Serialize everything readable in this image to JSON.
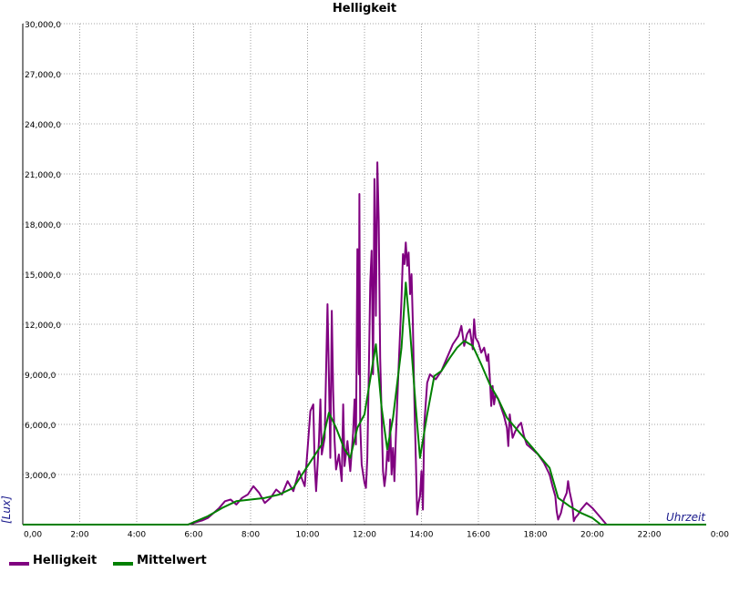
{
  "chart_data": {
    "type": "line",
    "title": "Helligkeit",
    "xlabel": "Uhrzeit",
    "ylabel": "[Lux]",
    "x_ticks": [
      "0,00",
      "2:00",
      "4:00",
      "6:00",
      "8:00",
      "10:00",
      "12:00",
      "14:00",
      "16:00",
      "18:00",
      "20:00",
      "22:00",
      "0:00"
    ],
    "y_ticks": [
      "3,000,0",
      "6,000,0",
      "9,000,0",
      "12,000,0",
      "15,000,0",
      "18,000,0",
      "21,000,0",
      "24,000,0",
      "27,000,0",
      "30,000,0"
    ],
    "xlim": [
      0,
      24
    ],
    "ylim": [
      0,
      30000
    ],
    "grid": true,
    "legend_position": "bottom-left",
    "series": [
      {
        "name": "Helligkeit",
        "color": "#800080",
        "points": [
          [
            0,
            0
          ],
          [
            5.8,
            0
          ],
          [
            6.0,
            100
          ],
          [
            6.3,
            250
          ],
          [
            6.5,
            400
          ],
          [
            6.7,
            700
          ],
          [
            6.9,
            1000
          ],
          [
            7.1,
            1400
          ],
          [
            7.3,
            1500
          ],
          [
            7.5,
            1200
          ],
          [
            7.7,
            1600
          ],
          [
            7.9,
            1800
          ],
          [
            8.1,
            2300
          ],
          [
            8.3,
            1900
          ],
          [
            8.5,
            1300
          ],
          [
            8.7,
            1600
          ],
          [
            8.9,
            2100
          ],
          [
            9.1,
            1800
          ],
          [
            9.3,
            2600
          ],
          [
            9.5,
            2000
          ],
          [
            9.7,
            3200
          ],
          [
            9.9,
            2300
          ],
          [
            10.0,
            4500
          ],
          [
            10.1,
            6800
          ],
          [
            10.2,
            7200
          ],
          [
            10.25,
            3600
          ],
          [
            10.3,
            2000
          ],
          [
            10.4,
            5000
          ],
          [
            10.45,
            7500
          ],
          [
            10.5,
            4200
          ],
          [
            10.6,
            5200
          ],
          [
            10.7,
            13200
          ],
          [
            10.75,
            9000
          ],
          [
            10.8,
            4000
          ],
          [
            10.85,
            12800
          ],
          [
            10.9,
            8000
          ],
          [
            10.95,
            5000
          ],
          [
            11.0,
            3300
          ],
          [
            11.1,
            4200
          ],
          [
            11.2,
            2600
          ],
          [
            11.25,
            7200
          ],
          [
            11.3,
            3500
          ],
          [
            11.4,
            5000
          ],
          [
            11.5,
            3200
          ],
          [
            11.6,
            5500
          ],
          [
            11.65,
            7500
          ],
          [
            11.7,
            4800
          ],
          [
            11.75,
            16500
          ],
          [
            11.8,
            9000
          ],
          [
            11.82,
            19800
          ],
          [
            11.85,
            6000
          ],
          [
            11.9,
            3600
          ],
          [
            12.0,
            2500
          ],
          [
            12.05,
            2200
          ],
          [
            12.1,
            4000
          ],
          [
            12.15,
            9000
          ],
          [
            12.2,
            14500
          ],
          [
            12.25,
            16400
          ],
          [
            12.3,
            9000
          ],
          [
            12.35,
            20700
          ],
          [
            12.4,
            12500
          ],
          [
            12.45,
            21700
          ],
          [
            12.5,
            18200
          ],
          [
            12.55,
            10000
          ],
          [
            12.6,
            6500
          ],
          [
            12.65,
            3200
          ],
          [
            12.7,
            2300
          ],
          [
            12.75,
            3000
          ],
          [
            12.8,
            4400
          ],
          [
            12.85,
            3800
          ],
          [
            12.9,
            6300
          ],
          [
            12.95,
            3000
          ],
          [
            13.0,
            4600
          ],
          [
            13.05,
            2600
          ],
          [
            13.1,
            5200
          ],
          [
            13.2,
            9500
          ],
          [
            13.3,
            13500
          ],
          [
            13.35,
            16200
          ],
          [
            13.4,
            15600
          ],
          [
            13.45,
            16900
          ],
          [
            13.5,
            15500
          ],
          [
            13.55,
            16300
          ],
          [
            13.6,
            13800
          ],
          [
            13.65,
            15000
          ],
          [
            13.7,
            12000
          ],
          [
            13.75,
            7500
          ],
          [
            13.8,
            4000
          ],
          [
            13.85,
            600
          ],
          [
            13.9,
            1300
          ],
          [
            13.95,
            1700
          ],
          [
            14.0,
            3200
          ],
          [
            14.05,
            900
          ],
          [
            14.1,
            6000
          ],
          [
            14.2,
            8500
          ],
          [
            14.3,
            9000
          ],
          [
            14.5,
            8700
          ],
          [
            14.7,
            9200
          ],
          [
            14.9,
            10000
          ],
          [
            15.1,
            10800
          ],
          [
            15.3,
            11300
          ],
          [
            15.4,
            11900
          ],
          [
            15.5,
            10700
          ],
          [
            15.6,
            11400
          ],
          [
            15.7,
            11700
          ],
          [
            15.8,
            10500
          ],
          [
            15.85,
            12300
          ],
          [
            15.9,
            11200
          ],
          [
            16.0,
            10900
          ],
          [
            16.1,
            10300
          ],
          [
            16.2,
            10600
          ],
          [
            16.3,
            9800
          ],
          [
            16.35,
            10200
          ],
          [
            16.4,
            8800
          ],
          [
            16.45,
            7100
          ],
          [
            16.5,
            8300
          ],
          [
            16.55,
            7200
          ],
          [
            16.6,
            7800
          ],
          [
            16.7,
            7500
          ],
          [
            16.8,
            7000
          ],
          [
            16.9,
            6500
          ],
          [
            17.0,
            5800
          ],
          [
            17.05,
            4700
          ],
          [
            17.1,
            6600
          ],
          [
            17.2,
            5200
          ],
          [
            17.3,
            5600
          ],
          [
            17.4,
            5900
          ],
          [
            17.5,
            6100
          ],
          [
            17.6,
            5300
          ],
          [
            17.7,
            4800
          ],
          [
            17.9,
            4500
          ],
          [
            18.1,
            4200
          ],
          [
            18.3,
            3700
          ],
          [
            18.5,
            3000
          ],
          [
            18.6,
            2300
          ],
          [
            18.7,
            1700
          ],
          [
            18.75,
            800
          ],
          [
            18.8,
            300
          ],
          [
            18.9,
            700
          ],
          [
            19.0,
            1500
          ],
          [
            19.1,
            1900
          ],
          [
            19.15,
            2600
          ],
          [
            19.2,
            2000
          ],
          [
            19.3,
            1200
          ],
          [
            19.35,
            200
          ],
          [
            19.4,
            400
          ],
          [
            19.5,
            600
          ],
          [
            19.6,
            900
          ],
          [
            19.8,
            1300
          ],
          [
            20.0,
            1000
          ],
          [
            20.2,
            600
          ],
          [
            20.5,
            0
          ],
          [
            24,
            0
          ]
        ]
      },
      {
        "name": "Mittelwert",
        "color": "#008000",
        "points": [
          [
            0,
            0
          ],
          [
            5.8,
            0
          ],
          [
            6.5,
            500
          ],
          [
            7.0,
            1000
          ],
          [
            7.5,
            1400
          ],
          [
            8.0,
            1500
          ],
          [
            8.5,
            1600
          ],
          [
            9.0,
            1800
          ],
          [
            9.5,
            2200
          ],
          [
            10.0,
            3500
          ],
          [
            10.5,
            4800
          ],
          [
            10.75,
            6700
          ],
          [
            11.0,
            5800
          ],
          [
            11.3,
            4500
          ],
          [
            11.5,
            4000
          ],
          [
            11.75,
            5800
          ],
          [
            12.0,
            6600
          ],
          [
            12.4,
            10800
          ],
          [
            12.6,
            7000
          ],
          [
            12.8,
            4500
          ],
          [
            13.0,
            6400
          ],
          [
            13.3,
            10600
          ],
          [
            13.45,
            14500
          ],
          [
            13.6,
            11600
          ],
          [
            13.8,
            7000
          ],
          [
            13.95,
            4000
          ],
          [
            14.2,
            6600
          ],
          [
            14.45,
            8900
          ],
          [
            14.7,
            9200
          ],
          [
            15.0,
            10000
          ],
          [
            15.25,
            10600
          ],
          [
            15.5,
            11000
          ],
          [
            15.8,
            10700
          ],
          [
            16.1,
            9600
          ],
          [
            16.4,
            8400
          ],
          [
            16.7,
            7500
          ],
          [
            17.0,
            6400
          ],
          [
            17.5,
            5400
          ],
          [
            18.0,
            4400
          ],
          [
            18.5,
            3400
          ],
          [
            18.8,
            1600
          ],
          [
            19.2,
            1100
          ],
          [
            19.6,
            700
          ],
          [
            20.0,
            400
          ],
          [
            20.3,
            0
          ],
          [
            24,
            0
          ]
        ]
      }
    ]
  },
  "legend": {
    "series_1": "Helligkeit",
    "series_2": "Mittelwert"
  }
}
